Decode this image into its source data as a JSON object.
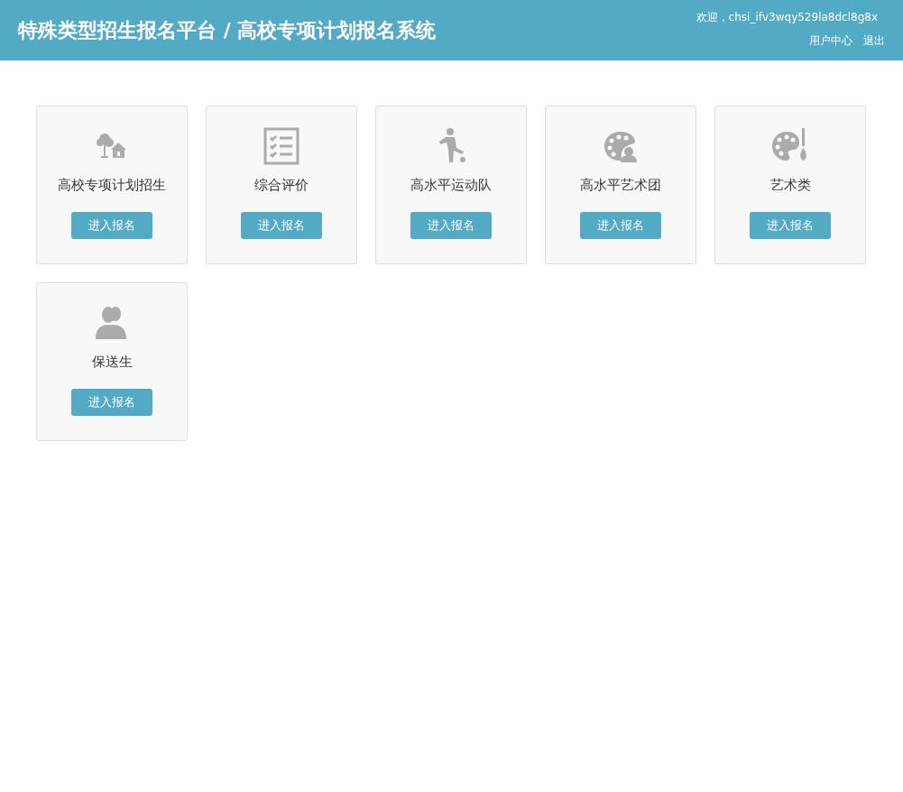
{
  "header": {
    "title": "特殊类型招生报名平台 / 高校专项计划报名系统",
    "welcome": "欢迎，chsi_ifv3wqy529la8dcl8g8x",
    "links": [
      "用户中心",
      "退出"
    ]
  },
  "cards": [
    {
      "kind": "tree-house",
      "label": "高校专项计划招生",
      "button": "进入报名"
    },
    {
      "kind": "checklist",
      "label": "综合评价",
      "button": "进入报名"
    },
    {
      "kind": "runner",
      "label": "高水平运动队",
      "button": "进入报名"
    },
    {
      "kind": "palette-person",
      "label": "高水平艺术团",
      "button": "进入报名"
    },
    {
      "kind": "palette-brush",
      "label": "艺术类",
      "button": "进入报名"
    },
    {
      "kind": "people",
      "label": "保送生",
      "button": "进入报名"
    }
  ]
}
